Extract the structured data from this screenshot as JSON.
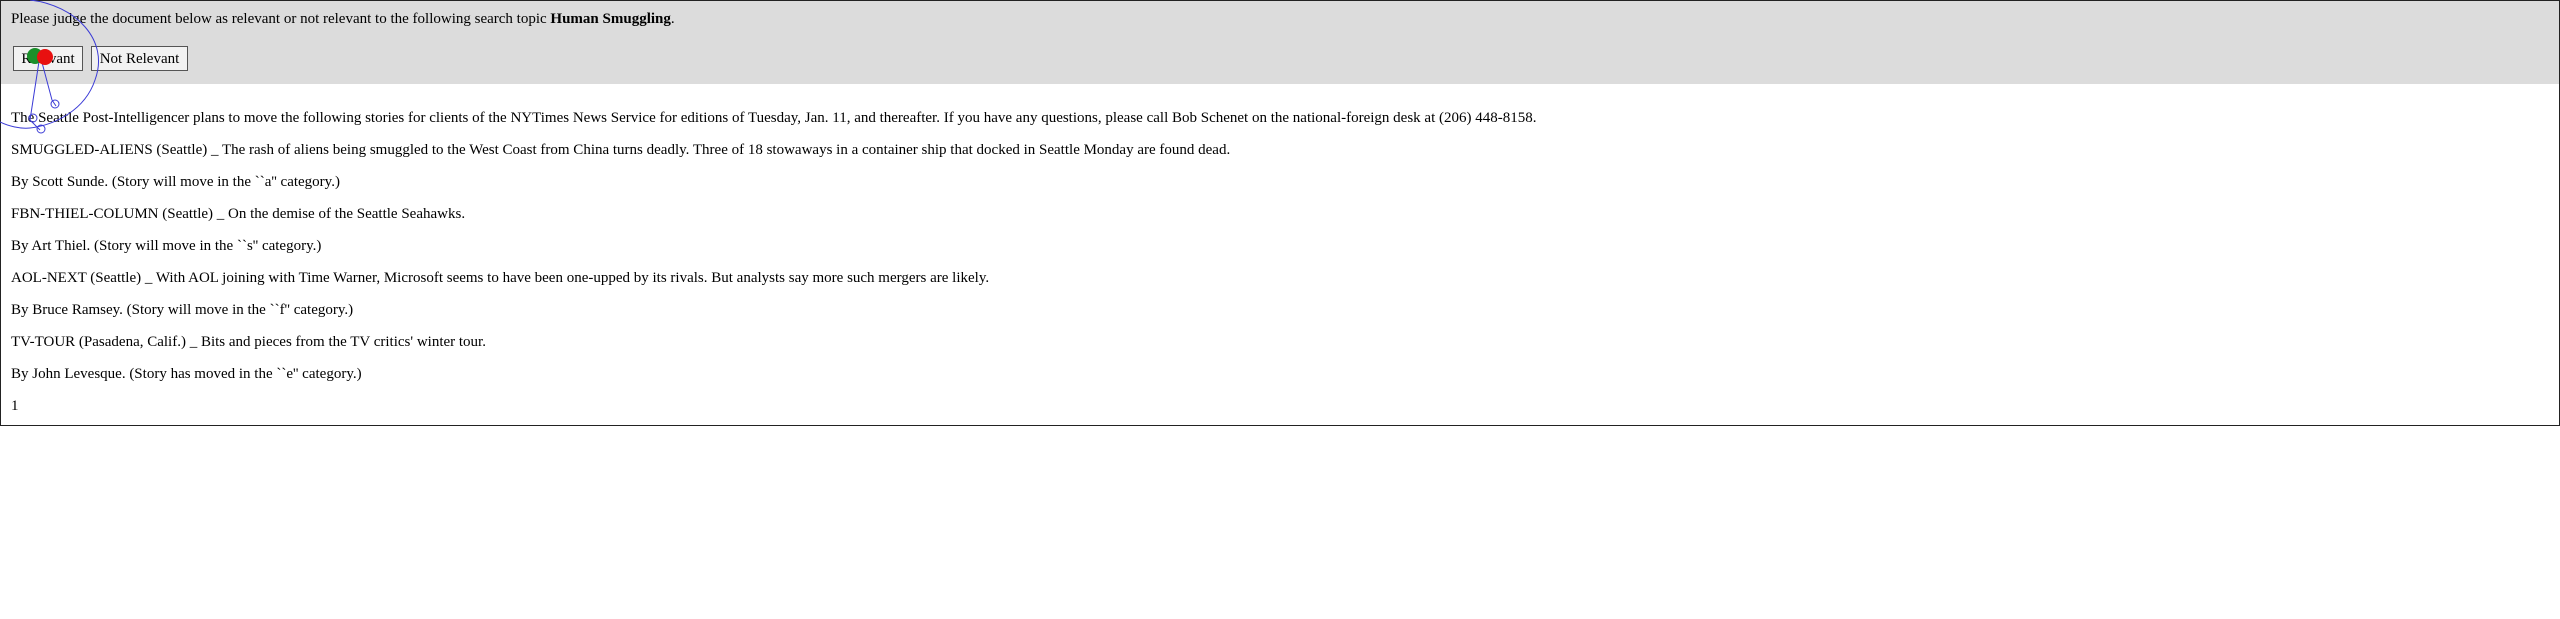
{
  "prompt": {
    "prefix": "Please judge the document below as relevant or not relevant to the following search topic ",
    "topic": "Human Smuggling",
    "suffix": "."
  },
  "buttons": {
    "relevant_label": "Relevant",
    "not_relevant_label": "Not Relevant"
  },
  "document": {
    "lines": [
      "The Seattle Post-Intelligencer plans to move the following stories for clients of the NYTimes News Service for editions of Tuesday, Jan. 11, and thereafter. If you have any questions, please call Bob Schenet on the national-foreign desk at (206) 448-8158.",
      "SMUGGLED-ALIENS (Seattle) _ The rash of aliens being smuggled to the West Coast from China turns deadly. Three of 18 stowaways in a container ship that docked in Seattle Monday are found dead.",
      "By Scott Sunde. (Story will move in the ``a'' category.)",
      "FBN-THIEL-COLUMN (Seattle) _ On the demise of the Seattle Seahawks.",
      "By Art Thiel. (Story will move in the ``s'' category.)",
      "AOL-NEXT (Seattle) _ With AOL joining with Time Warner, Microsoft seems to have been one-upped by its rivals. But analysts say more such mergers are likely.",
      "By Bruce Ramsey. (Story will move in the ``f'' category.)",
      "TV-TOUR (Pasadena, Calif.) _ Bits and pieces from the TV critics' winter tour.",
      "By John Levesque. (Story has moved in the ``e'' category.)",
      "1"
    ]
  },
  "overlay": {
    "cursor_colors": {
      "green": "#1a8f2a",
      "red": "#e81010",
      "trace": "#3b3bd6"
    }
  }
}
